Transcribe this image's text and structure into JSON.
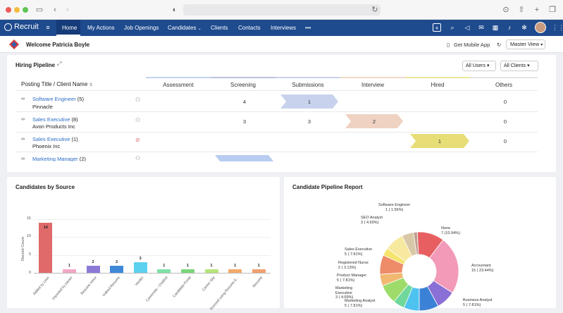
{
  "browser": {
    "url": ""
  },
  "nav": {
    "brand": "Recruit",
    "items": [
      "Home",
      "My Actions",
      "Job Openings",
      "Candidates",
      "Clients",
      "Contacts",
      "Interviews"
    ],
    "more": "•••"
  },
  "welcome": {
    "text": "Welcome Patricia Boyle",
    "mobile": "Get Mobile App",
    "view": "Master View"
  },
  "pipeline": {
    "title": "Hiring Pipeline",
    "filter_users": "All Users",
    "filter_clients": "All Clients",
    "col_title": "Posting Title / Client Name",
    "stages": [
      "Assessment",
      "Screening",
      "Submissions",
      "Interview",
      "Hired",
      "Others"
    ],
    "rows": [
      {
        "title": "Software Engineer",
        "count": "(5)",
        "client": "Pinnacle",
        "screening": "4",
        "submissions": "",
        "interview": "",
        "hired": "",
        "others": "0",
        "chevron": "1"
      },
      {
        "title": "Sales Executive",
        "count": "(8)",
        "client": "Avon Products Inc",
        "screening": "3",
        "submissions": "3",
        "interview": "",
        "hired": "",
        "others": "0",
        "chevron": "2"
      },
      {
        "title": "Sales Executive",
        "count": "(1)",
        "client": "Phoenix Inc",
        "screening": "",
        "submissions": "",
        "interview": "",
        "hired": "",
        "others": "0",
        "chevron": "1"
      },
      {
        "title": "Marketing Manager",
        "count": "(2)",
        "client": "",
        "screening": "",
        "submissions": "",
        "interview": "",
        "hired": "",
        "others": "",
        "chevron": ""
      }
    ],
    "colors": {
      "submissions": "#c9d2ec",
      "interview": "#efd2c2",
      "hired": "#e8de78",
      "assessment": "#b8cdf0"
    }
  },
  "sources": {
    "title": "Candidates by Source",
    "ylabel": "Record Count",
    "yticks": [
      "15",
      "10",
      "5",
      "0"
    ]
  },
  "chart_data": [
    {
      "type": "bar",
      "title": "Candidates by Source",
      "xlabel": "",
      "ylabel": "Record Count",
      "ylim": [
        0,
        15
      ],
      "categories": [
        "Added by User",
        "Imported by parser",
        "Resume Inbox",
        "Indeed Resume",
        "Vendor",
        "Careersite - Chatbot",
        "Candidate Portal",
        "Career Site",
        "Sourced using Resume E...",
        "Resume"
      ],
      "values": [
        14,
        1,
        2,
        2,
        3,
        1,
        1,
        1,
        1,
        1
      ],
      "colors": [
        "#e06a6a",
        "#f2a7c6",
        "#8d7ad6",
        "#3f88d8",
        "#5bd0ef",
        "#7fe0a6",
        "#7bd67a",
        "#b8e47a",
        "#f2aa6a",
        "#f0a070"
      ],
      "grid": true
    },
    {
      "type": "pie",
      "title": "Candidate Pipeline Report",
      "slices": [
        {
          "label": "None",
          "value": 7,
          "pct": "7 (10.94%)",
          "color": "#e85f62"
        },
        {
          "label": "Accountant",
          "value": 15,
          "pct": "15 ( 23.44%)",
          "color": "#f29ab8"
        },
        {
          "label": "Business Analyst",
          "value": 5,
          "pct": "5 ( 7.81%)",
          "color": "#8a6fd6"
        },
        {
          "label": "",
          "value": 5,
          "pct": "",
          "color": "#3b82d6"
        },
        {
          "label": "",
          "value": 4,
          "pct": "",
          "color": "#4fc3f0"
        },
        {
          "label": "",
          "value": 3,
          "pct": "",
          "color": "#6fd89a"
        },
        {
          "label": "Marketing Analyst",
          "value": 5,
          "pct": "5 ( 7.81%)",
          "color": "#9ddc6a"
        },
        {
          "label": "Marketing Executive",
          "value": 3,
          "pct": "3 ( 4.69%)",
          "color": "#f0b870"
        },
        {
          "label": "Product Manager",
          "value": 5,
          "pct": "5 ( 7.81%)",
          "color": "#ee8c6a"
        },
        {
          "label": "Registered Nurse",
          "value": 2,
          "pct": "2 ( 3.13%)",
          "color": "#f5e46a"
        },
        {
          "label": "Sales Executive",
          "value": 5,
          "pct": "5 ( 7.81%)",
          "color": "#f7e9a0"
        },
        {
          "label": "SEO Analyst",
          "value": 3,
          "pct": "3 ( 4.69%)",
          "color": "#d9c8a8"
        },
        {
          "label": "Software Engineer",
          "value": 1,
          "pct": "1 ( 1.56%)",
          "color": "#c0a090"
        }
      ]
    }
  ],
  "pie_labels": {
    "software": [
      "Software Engineer",
      "1 ( 1.56%)"
    ],
    "seo": [
      "SEO Analyst",
      "3 ( 4.69%)"
    ],
    "sales": [
      "Sales Executive",
      "5 ( 7.81%)"
    ],
    "nurse": [
      "Registered Nurse",
      "2 ( 3.13%)"
    ],
    "product": [
      "Product Manager",
      "5 ( 7.81%)"
    ],
    "marketing_exec": [
      "Marketing",
      "Executive",
      "3 ( 4.69%)"
    ],
    "marketing_analyst": [
      "Marketing Analyst",
      "5 ( 7.81%)"
    ],
    "none": [
      "None",
      "7 (10.94%)"
    ],
    "accountant": [
      "Accountant",
      "15 ( 23.44%)"
    ],
    "business": [
      "Business Analyst",
      "5 ( 7.81%)"
    ]
  },
  "report": {
    "title": "Candidate Pipeline Report"
  }
}
